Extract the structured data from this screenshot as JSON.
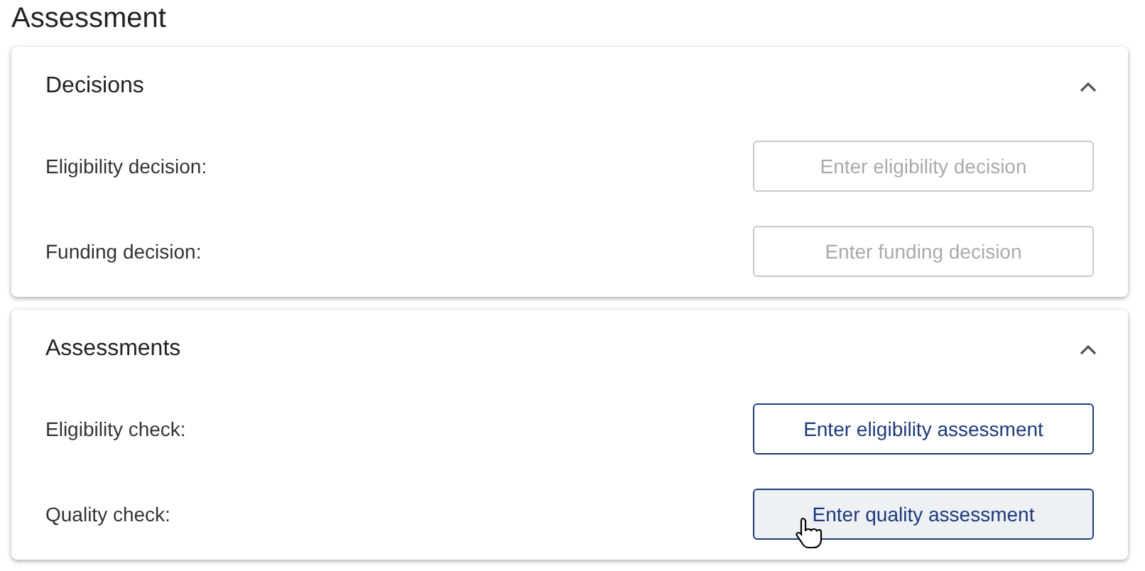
{
  "title": "Assessment",
  "sections": [
    {
      "title": "Decisions",
      "expanded": true,
      "rows": [
        {
          "label": "Eligibility decision:",
          "button": "Enter eligibility decision",
          "disabled": true,
          "hovered": false
        },
        {
          "label": "Funding decision:",
          "button": "Enter funding decision",
          "disabled": true,
          "hovered": false
        }
      ]
    },
    {
      "title": "Assessments",
      "expanded": true,
      "rows": [
        {
          "label": "Eligibility check:",
          "button": "Enter eligibility assessment",
          "disabled": false,
          "hovered": false
        },
        {
          "label": "Quality check:",
          "button": "Enter quality assessment",
          "disabled": false,
          "hovered": true
        }
      ]
    }
  ]
}
